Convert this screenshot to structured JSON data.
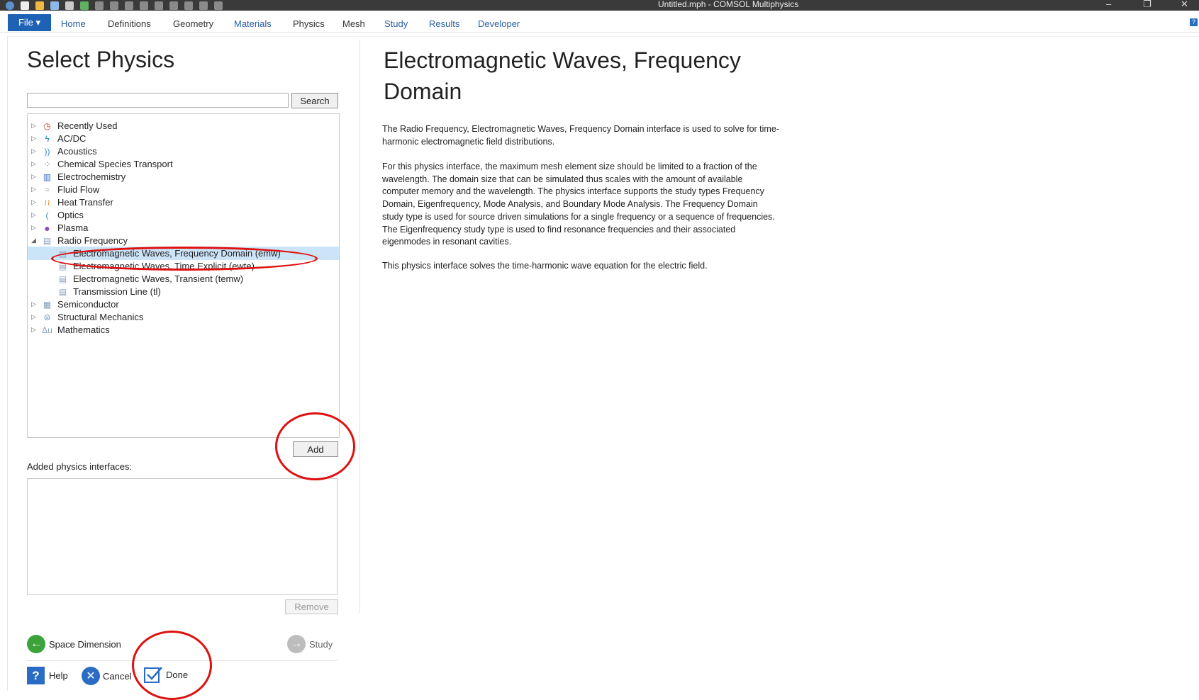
{
  "window": {
    "title": "Untitled.mph - COMSOL Multiphysics",
    "minimize": "–",
    "restore": "❐",
    "close": "✕"
  },
  "ribbon": {
    "file_label": "File ▾",
    "tabs": [
      "Home",
      "Definitions",
      "Geometry",
      "Materials",
      "Physics",
      "Mesh",
      "Study",
      "Results",
      "Developer"
    ],
    "help": "?"
  },
  "left": {
    "title": "Select Physics",
    "search_button": "Search",
    "tree": [
      {
        "label": "Recently Used",
        "icon": "clock-icon",
        "expanded": false
      },
      {
        "label": "AC/DC",
        "icon": "acdc-icon",
        "expanded": false
      },
      {
        "label": "Acoustics",
        "icon": "acoustics-icon",
        "expanded": false
      },
      {
        "label": "Chemical Species Transport",
        "icon": "chemical-icon",
        "expanded": false
      },
      {
        "label": "Electrochemistry",
        "icon": "electrochemistry-icon",
        "expanded": false
      },
      {
        "label": "Fluid Flow",
        "icon": "fluid-icon",
        "expanded": false
      },
      {
        "label": "Heat Transfer",
        "icon": "heat-icon",
        "expanded": false
      },
      {
        "label": "Optics",
        "icon": "optics-icon",
        "expanded": false
      },
      {
        "label": "Plasma",
        "icon": "plasma-icon",
        "expanded": false
      },
      {
        "label": "Radio Frequency",
        "icon": "rf-icon",
        "expanded": true
      },
      {
        "label": "Electromagnetic Waves, Frequency Domain (emw)",
        "icon": "rf-interface-icon",
        "child": true,
        "selected": true
      },
      {
        "label": "Electromagnetic Waves, Time Explicit (ewte)",
        "icon": "rf-interface-icon",
        "child": true
      },
      {
        "label": "Electromagnetic Waves, Transient (temw)",
        "icon": "rf-interface-icon",
        "child": true
      },
      {
        "label": "Transmission Line (tl)",
        "icon": "rf-interface-icon",
        "child": true
      },
      {
        "label": "Semiconductor",
        "icon": "semiconductor-icon",
        "expanded": false
      },
      {
        "label": "Structural Mechanics",
        "icon": "structural-icon",
        "expanded": false
      },
      {
        "label": "Mathematics",
        "icon": "math-icon",
        "expanded": false
      }
    ],
    "add_button": "Add",
    "added_label": "Added physics interfaces:",
    "remove_button": "Remove",
    "back_label": "Space Dimension",
    "next_label": "Study",
    "help_label": "Help",
    "cancel_label": "Cancel",
    "done_label": "Done"
  },
  "right": {
    "title": "Electromagnetic Waves, Frequency Domain",
    "paragraphs": [
      "The Radio Frequency, Electromagnetic Waves, Frequency Domain interface is used to solve for time-harmonic electromagnetic field distributions.",
      "For this physics interface, the maximum mesh element size should be limited to a fraction of the wavelength. The domain size that can be simulated thus scales with the amount of available computer memory and the wavelength. The physics interface supports the study types Frequency Domain, Eigenfrequency, Mode Analysis, and Boundary Mode Analysis. The Frequency Domain study type is used for source driven simulations for a single frequency or a sequence of frequencies. The Eigenfrequency study type is used to find resonance frequencies and their associated eigenmodes in resonant cavities.",
      "This physics interface solves the time-harmonic wave equation for the electric field."
    ]
  },
  "colors": {
    "accent": "#1e62b5",
    "selection": "#cce4f7",
    "annotation": "#e01010"
  }
}
